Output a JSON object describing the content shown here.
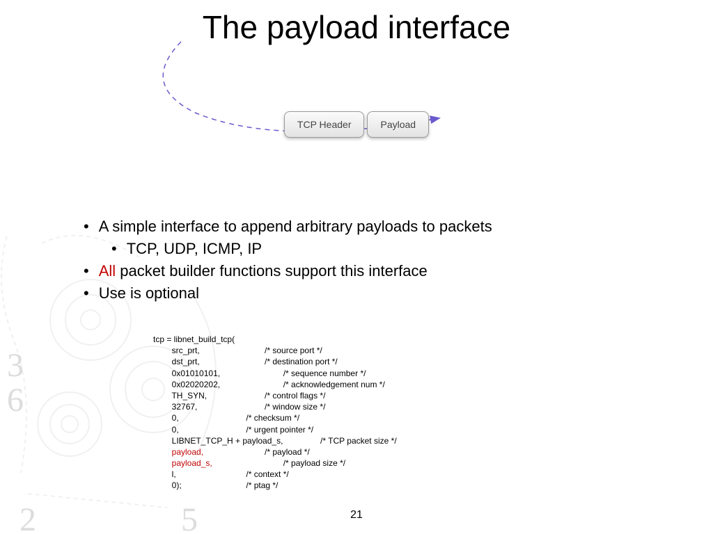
{
  "title": "The payload interface",
  "diagram": {
    "box1": "TCP Header",
    "box2": "Payload"
  },
  "bullets": {
    "b1": "A simple interface to append arbitrary payloads to packets",
    "b1a": "TCP, UDP, ICMP, IP",
    "b2_red": "All",
    "b2_rest": " packet builder functions support this interface",
    "b3": "Use is optional"
  },
  "code": {
    "l0": "tcp = libnet_build_tcp(",
    "l1a": "        src_prt,",
    "l1c": "/* source port */",
    "l2a": "        dst_prt,",
    "l2c": "/* destination port */",
    "l3a": "        0x01010101,",
    "l3c": "/* sequence number */",
    "l4a": "        0x02020202,",
    "l4c": "/* acknowledgement num */",
    "l5a": "        TH_SYN,",
    "l5c": "/* control flags */",
    "l6a": "        32767,",
    "l6c": "/* window size */",
    "l7a": "        0,",
    "l7c": "/* checksum */",
    "l8a": "        0,",
    "l8c": "/* urgent pointer */",
    "l9a": "        LIBNET_TCP_H + payload_s,",
    "l9c": "/* TCP packet size */",
    "l10a": "        payload,",
    "l10c": "/* payload */",
    "l11a": "        payload_s,",
    "l11c": "/* payload size */",
    "l12a": "        l,",
    "l12c": "/* context */",
    "l13a": "        0);",
    "l13c": "/* ptag */"
  },
  "bg_numbers": {
    "n3": "3",
    "n6": "6",
    "n2": "2",
    "n5": "5"
  },
  "page": "21"
}
